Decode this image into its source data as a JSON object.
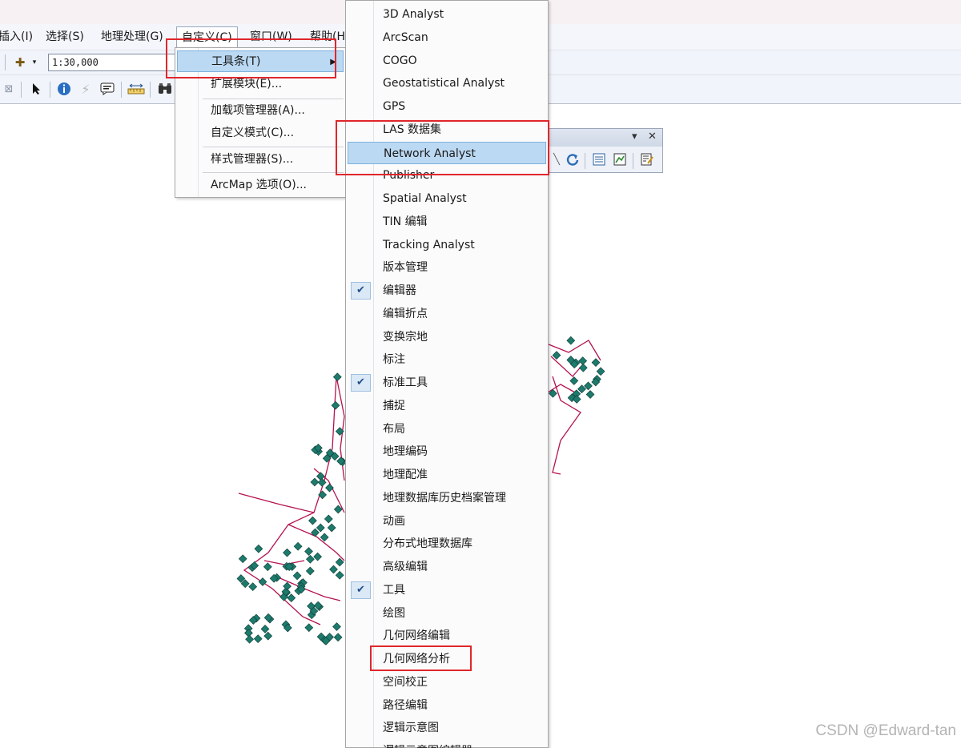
{
  "menubar": {
    "items": [
      "插入(I)",
      "选择(S)",
      "地理处理(G)",
      "自定义(C)",
      "窗口(W)",
      "帮助(H)"
    ]
  },
  "toolbar": {
    "scale_value": "1:30,000"
  },
  "customize_menu": {
    "items": [
      "工具条(T)",
      "扩展模块(E)...",
      "加载项管理器(A)...",
      "自定义模式(C)...",
      "样式管理器(S)...",
      "ArcMap 选项(O)..."
    ],
    "highlighted": "工具条(T)"
  },
  "toolbars_submenu": {
    "items": [
      {
        "label": "3D Analyst",
        "checked": false
      },
      {
        "label": "ArcScan",
        "checked": false
      },
      {
        "label": "COGO",
        "checked": false
      },
      {
        "label": "Geostatistical Analyst",
        "checked": false
      },
      {
        "label": "GPS",
        "checked": false
      },
      {
        "label": "LAS 数据集",
        "checked": false
      },
      {
        "label": "Network Analyst",
        "checked": false,
        "highlighted": true
      },
      {
        "label": "Publisher",
        "checked": false
      },
      {
        "label": "Spatial Analyst",
        "checked": false
      },
      {
        "label": "TIN 编辑",
        "checked": false
      },
      {
        "label": "Tracking Analyst",
        "checked": false
      },
      {
        "label": "版本管理",
        "checked": false
      },
      {
        "label": "编辑器",
        "checked": true
      },
      {
        "label": "编辑折点",
        "checked": false
      },
      {
        "label": "变换宗地",
        "checked": false
      },
      {
        "label": "标注",
        "checked": false
      },
      {
        "label": "标准工具",
        "checked": true
      },
      {
        "label": "捕捉",
        "checked": false
      },
      {
        "label": "布局",
        "checked": false
      },
      {
        "label": "地理编码",
        "checked": false
      },
      {
        "label": "地理配准",
        "checked": false
      },
      {
        "label": "地理数据库历史档案管理",
        "checked": false
      },
      {
        "label": "动画",
        "checked": false
      },
      {
        "label": "分布式地理数据库",
        "checked": false
      },
      {
        "label": "高级编辑",
        "checked": false
      },
      {
        "label": "工具",
        "checked": true
      },
      {
        "label": "绘图",
        "checked": false
      },
      {
        "label": "几何网络编辑",
        "checked": false
      },
      {
        "label": "几何网络分析",
        "checked": false
      },
      {
        "label": "空间校正",
        "checked": false
      },
      {
        "label": "路径编辑",
        "checked": false
      },
      {
        "label": "逻辑示意图",
        "checked": false
      },
      {
        "label": "逻辑示意图编辑器",
        "checked": false
      }
    ]
  },
  "watermark": "CSDN @Edward-tan",
  "colors": {
    "highlight": "#bcd9f3",
    "annotation_red": "#e0262b",
    "network_line": "#b3124f",
    "network_node": "#1d7a6c"
  }
}
